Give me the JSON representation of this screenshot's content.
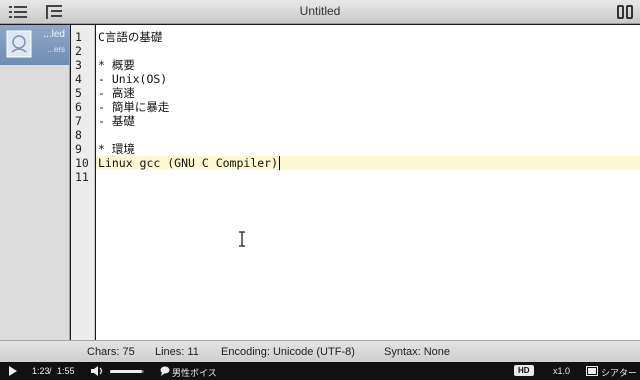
{
  "window": {
    "title": "Untitled"
  },
  "sidebar": {
    "document": {
      "line1": "...led",
      "line2": "...ers"
    }
  },
  "editor": {
    "line_numbers": [
      "1",
      "2",
      "3",
      "4",
      "5",
      "6",
      "7",
      "8",
      "9",
      "10",
      "11"
    ],
    "lines": [
      "C言語の基礎",
      "",
      "* 概要",
      "- Unix(OS)",
      "- 高速",
      "- 簡単に暴走",
      "- 基礎",
      "",
      "* 環境",
      "Linux gcc (GNU C Compiler)",
      ""
    ],
    "current_line": 10,
    "current_line_color": "#fdf7d2"
  },
  "statusbar": {
    "chars": "Chars: 75",
    "lines": "Lines: 11",
    "encoding": "Encoding: Unicode (UTF-8)",
    "syntax": "Syntax: None"
  },
  "player": {
    "time_current": "1:23",
    "time_separator": "/",
    "time_total": "1:55",
    "volume_level": 0.95,
    "voice_label": "男性ボイス",
    "hd_label": "HD",
    "speed_label": "x1.0",
    "theater_label": "シアター",
    "icons": [
      "play-icon",
      "volume-icon",
      "speech-bubble-icon",
      "theater-icon"
    ]
  }
}
